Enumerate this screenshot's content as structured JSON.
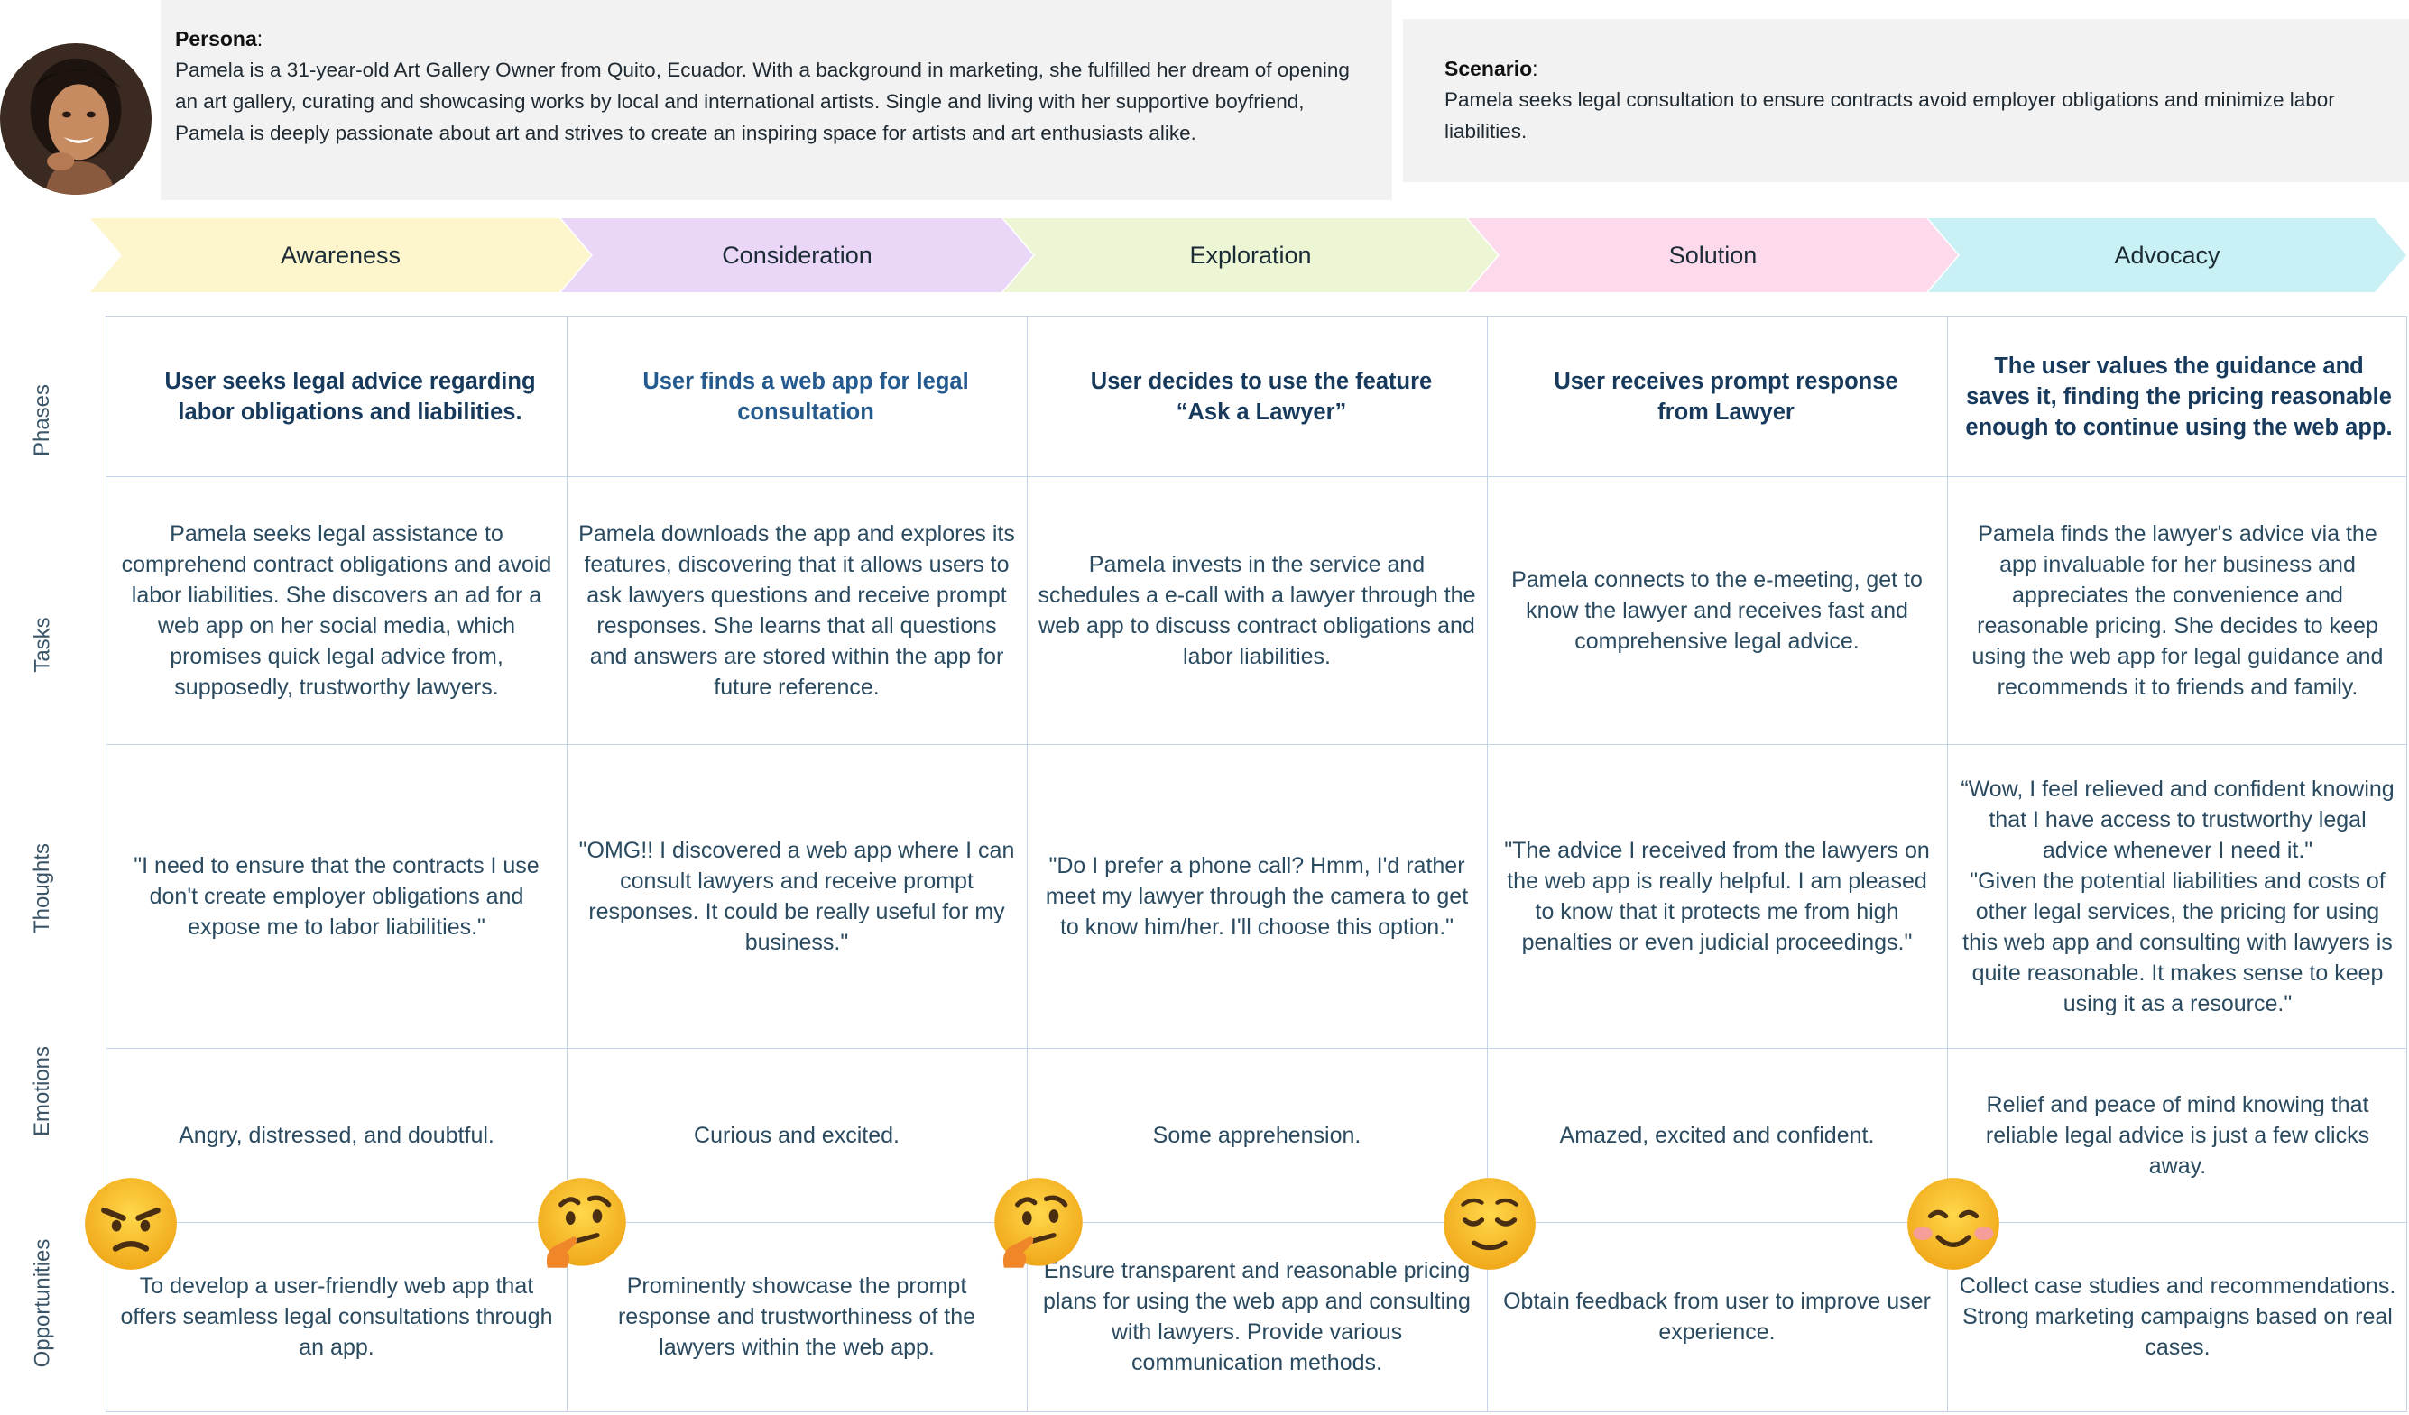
{
  "persona": {
    "label": "Persona",
    "text": "Pamela is a 31-year-old Art Gallery Owner from Quito, Ecuador. With a background in marketing, she fulfilled her dream of opening an art gallery, curating and showcasing works by local and international artists. Single and living with her supportive boyfriend, Pamela is deeply passionate about art and strives to create an inspiring space for artists and art enthusiasts alike."
  },
  "scenario": {
    "label": "Scenario",
    "text": "Pamela seeks legal consultation to ensure contracts avoid employer obligations and minimize labor liabilities."
  },
  "stages": [
    {
      "label": "Awareness",
      "color": "#c9f1f5"
    },
    {
      "label": "Consideration",
      "color": "#fdf5cc"
    },
    {
      "label": "Exploration",
      "color": "#ead6f7"
    },
    {
      "label": "Solution",
      "color": "#edf6d4"
    },
    {
      "label": "Advocacy",
      "color": "#fdd9ec"
    }
  ],
  "row_labels": [
    "Phases",
    "Tasks",
    "Thoughts",
    "Emotions",
    "Opportunities"
  ],
  "phases": [
    "User seeks legal advice regarding labor obligations and liabilities.",
    "User finds a web app for legal consultation",
    "User decides to use the feature “Ask a Lawyer”",
    "User receives prompt response from Lawyer",
    "The user values the guidance and saves it, finding the pricing reasonable enough to continue using the web app."
  ],
  "tasks": [
    "Pamela seeks legal assistance to comprehend contract obligations and avoid labor liabilities. She discovers an ad for a web app on her social media, which promises quick legal advice from, supposedly, trustworthy lawyers.",
    "Pamela downloads the app and explores its features, discovering that it allows users to ask lawyers questions and receive prompt responses. She learns that all questions and answers are stored within the app for future reference.",
    "Pamela invests in the service and schedules a e-call with a lawyer through the web app to discuss contract obligations and labor liabilities.",
    "Pamela connects to the e-meeting, get to know the lawyer and receives fast and comprehensive legal advice.",
    "Pamela finds the lawyer's advice via the app invaluable for her business and appreciates the convenience and reasonable pricing. She decides to keep using the web app for legal guidance and recommends it to friends and family."
  ],
  "thoughts": [
    "\"I need to ensure that the contracts I use don't create employer obligations and expose me to labor liabilities.\"",
    "\"OMG!! I discovered a web app where I can consult lawyers and receive prompt responses. It could be really useful for my business.\"",
    "\"Do I prefer a phone call? Hmm, I'd rather meet my lawyer through the camera to get to know him/her. I'll choose this option.\"",
    "\"The advice I received from the lawyers on the web app is really helpful. I am pleased to know that it protects me from high penalties or even judicial proceedings.\"",
    "“Wow, I feel relieved and confident knowing that I have access to trustworthy legal advice whenever I need it.\"\n\"Given the potential liabilities and costs of other legal services, the pricing for using this web app and consulting with lawyers is quite reasonable. It makes sense to keep using it as a resource.\""
  ],
  "emotions": [
    "Angry, distressed, and doubtful.",
    "Curious and excited.",
    "Some apprehension.",
    "Amazed, excited and confident.",
    "Relief and peace of mind knowing that reliable legal advice is just a few clicks away."
  ],
  "emoji_icons": [
    "angry-face-icon",
    "thinking-face-icon",
    "thinking-face-icon",
    "relieved-face-icon",
    "smiling-face-icon"
  ],
  "opportunities": [
    "To develop a user-friendly web app that offers seamless legal consultations through an app.",
    "Prominently showcase the prompt response and trustworthiness of the lawyers within the web app.",
    "Ensure transparent and reasonable pricing plans for using the web app and consulting with lawyers. Provide various communication methods.",
    "Obtain feedback from user to improve user experience.",
    "Collect case studies and recommendations. Strong marketing campaigns based on real cases."
  ]
}
